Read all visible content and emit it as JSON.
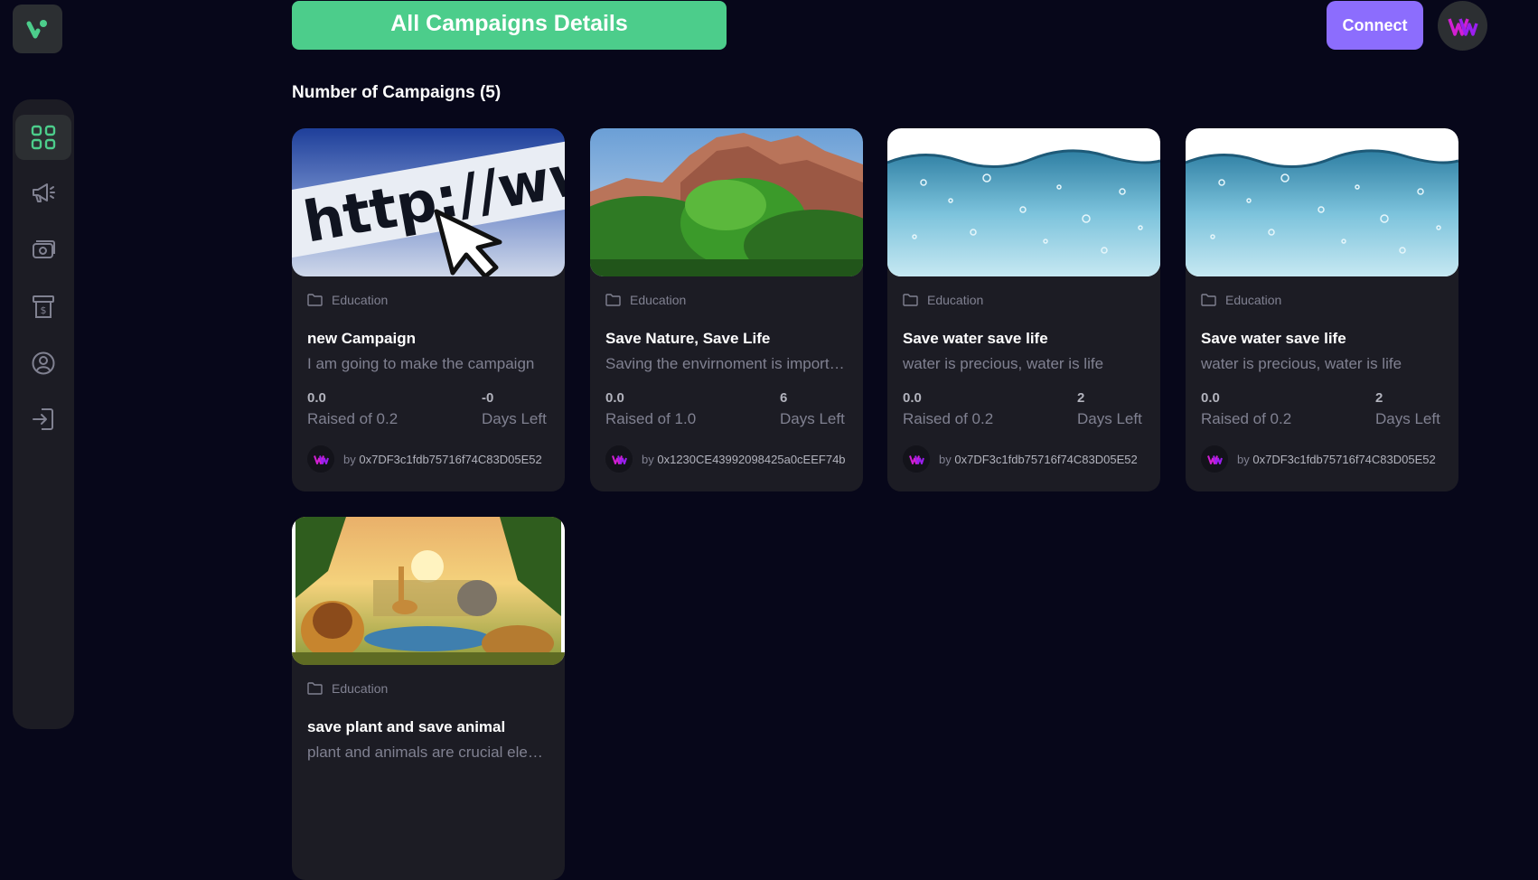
{
  "header": {
    "title_button": "All Campaigns Details",
    "connect_label": "Connect"
  },
  "sidebar": {
    "items": [
      {
        "icon": "dashboard-icon",
        "active": true
      },
      {
        "icon": "campaign-icon",
        "active": false
      },
      {
        "icon": "payment-icon",
        "active": false
      },
      {
        "icon": "withdraw-icon",
        "active": false
      },
      {
        "icon": "profile-icon",
        "active": false
      },
      {
        "icon": "logout-icon",
        "active": false
      }
    ]
  },
  "main": {
    "heading": "Number of Campaigns (5)",
    "campaigns": [
      {
        "image": "browser-url-image",
        "category": "Education",
        "title": "new Campaign",
        "description": "I am going to make the campaign",
        "raised": "0.0",
        "raised_label": "Raised of 0.2",
        "days": "-0",
        "days_label": "Days Left",
        "owner_prefix": "by",
        "owner": "0x7DF3c1fdb75716f74C83D05E52"
      },
      {
        "image": "nature-canyon-image",
        "category": "Education",
        "title": "Save Nature, Save Life",
        "description": "Saving the envirnoment is important",
        "raised": "0.0",
        "raised_label": "Raised of 1.0",
        "days": "6",
        "days_label": "Days Left",
        "owner_prefix": "by",
        "owner": "0x1230CE43992098425a0cEEF74b"
      },
      {
        "image": "water-bubbles-image",
        "category": "Education",
        "title": "Save water save life",
        "description": "water is precious, water is life",
        "raised": "0.0",
        "raised_label": "Raised of 0.2",
        "days": "2",
        "days_label": "Days Left",
        "owner_prefix": "by",
        "owner": "0x7DF3c1fdb75716f74C83D05E52"
      },
      {
        "image": "water-bubbles-image",
        "category": "Education",
        "title": "Save water save life",
        "description": "water is precious, water is life",
        "raised": "0.0",
        "raised_label": "Raised of 0.2",
        "days": "2",
        "days_label": "Days Left",
        "owner_prefix": "by",
        "owner": "0x7DF3c1fdb75716f74C83D05E52"
      },
      {
        "image": "animals-jungle-image",
        "category": "Education",
        "title": "save plant and save animal",
        "description": "plant and animals are crucial elements",
        "raised": "",
        "raised_label": "",
        "days": "",
        "days_label": "",
        "owner_prefix": "",
        "owner": ""
      }
    ]
  },
  "colors": {
    "background": "#07071a",
    "card": "#1c1c24",
    "accent_green": "#4ccd8b",
    "accent_purple": "#8c6dfd",
    "muted_text": "#808191",
    "brand_magenta": "#d21fd3"
  }
}
